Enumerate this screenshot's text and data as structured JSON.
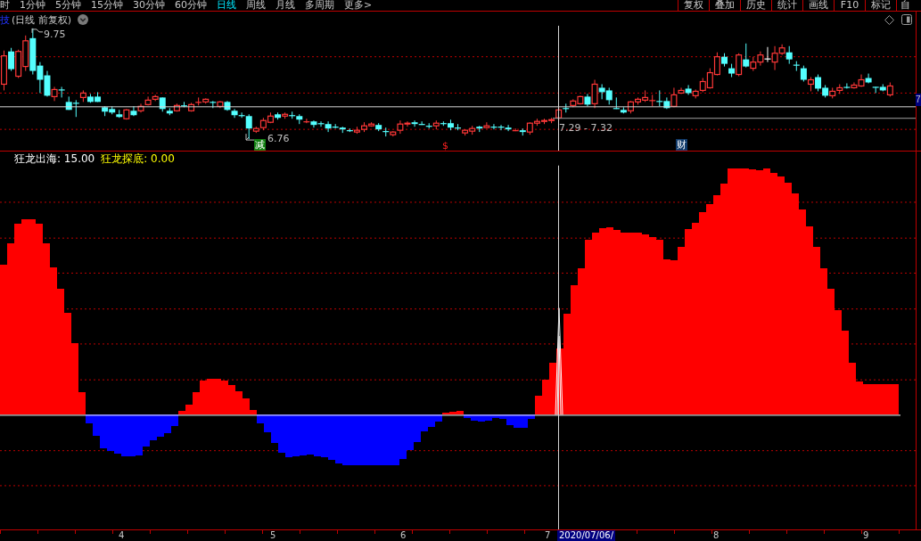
{
  "toolbar": {
    "periods": [
      {
        "label": "时",
        "selected": false
      },
      {
        "label": "1分钟",
        "selected": false
      },
      {
        "label": "5分钟",
        "selected": false
      },
      {
        "label": "15分钟",
        "selected": false
      },
      {
        "label": "30分钟",
        "selected": false
      },
      {
        "label": "60分钟",
        "selected": false
      },
      {
        "label": "日线",
        "selected": true
      },
      {
        "label": "周线",
        "selected": false
      },
      {
        "label": "月线",
        "selected": false
      },
      {
        "label": "多周期",
        "selected": false
      },
      {
        "label": "更多>",
        "selected": false
      }
    ],
    "tools": [
      "复权",
      "叠加",
      "历史",
      "统计",
      "画线",
      "F10",
      "标记",
      "自"
    ]
  },
  "chart_header": {
    "label": "技",
    "title": "(日线 前复权)"
  },
  "price_chart": {
    "high_label": "9.75",
    "low_label": "6.76",
    "crosshair_range": "7.29 - 7.32",
    "axis_price": "7",
    "markers": [
      {
        "kind": "reduce",
        "text": "减"
      },
      {
        "kind": "dividend",
        "text": "$"
      },
      {
        "kind": "finance",
        "text": "财"
      }
    ]
  },
  "indicator": {
    "lines": [
      {
        "label": "狂龙出海: 15.00",
        "color": "#ffffff"
      },
      {
        "label": "狂龙探底: 0.00",
        "color": "#ffff00"
      }
    ]
  },
  "time_axis": {
    "labels": [
      "4",
      "5",
      "6",
      "7",
      "8",
      "9"
    ],
    "cursor_date": "2020/07/06/"
  }
}
